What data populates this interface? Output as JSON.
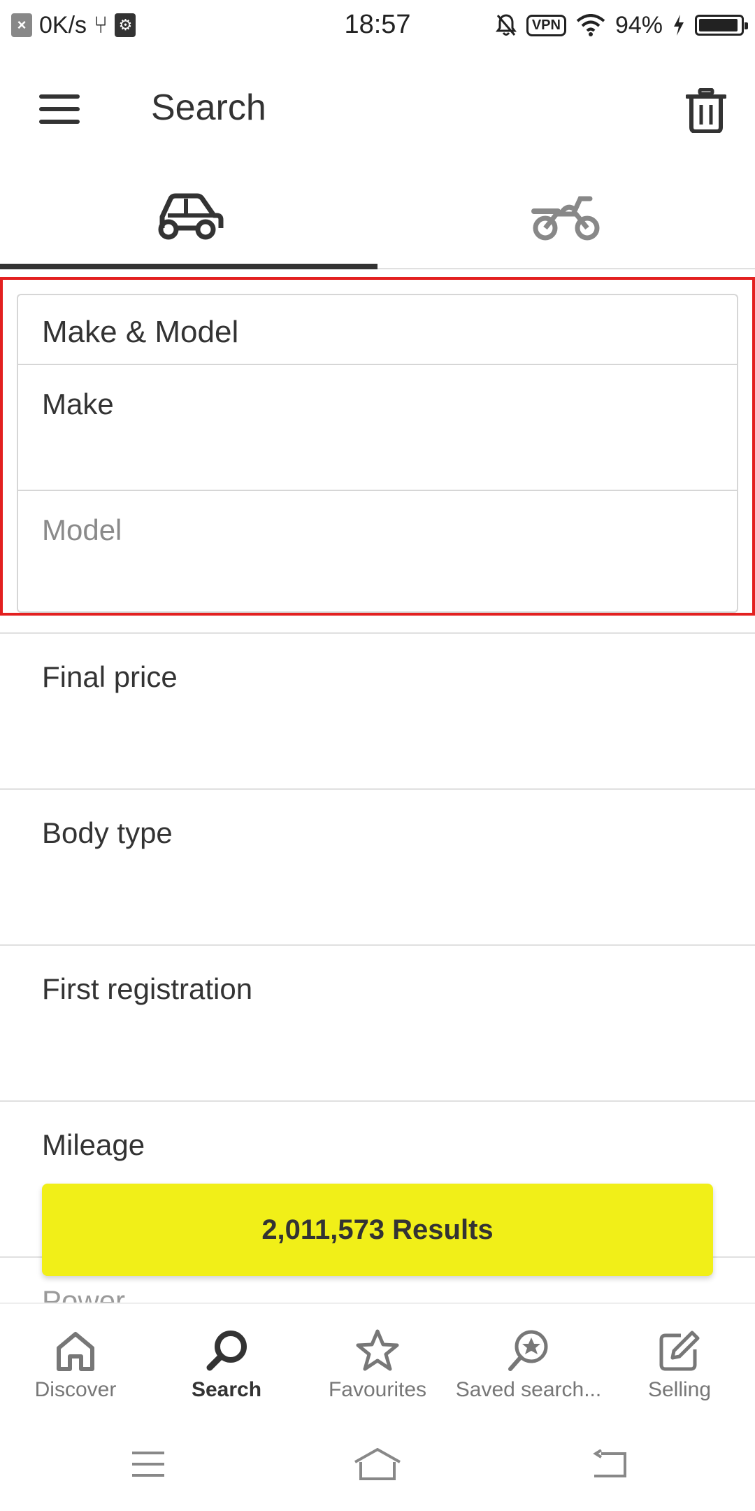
{
  "status_bar": {
    "speed": "0K/s",
    "time": "18:57",
    "vpn": "VPN",
    "battery": "94%"
  },
  "app_bar": {
    "title": "Search",
    "menu_icon": "hamburger-menu-icon",
    "trash_icon": "trash-icon"
  },
  "tabs": [
    {
      "icon": "car-icon",
      "active": true
    },
    {
      "icon": "motorbike-icon",
      "active": false
    }
  ],
  "make_model": {
    "header": "Make & Model",
    "make_label": "Make",
    "model_label": "Model"
  },
  "filters": [
    "Final price",
    "Body type",
    "First registration",
    "Mileage",
    "Power"
  ],
  "results_button": {
    "label": "2,011,573 Results",
    "color": "#f1ef18"
  },
  "bottom_nav": [
    {
      "label": "Discover",
      "icon": "home-icon",
      "active": false
    },
    {
      "label": "Search",
      "icon": "search-icon",
      "active": true
    },
    {
      "label": "Favourites",
      "icon": "star-icon",
      "active": false
    },
    {
      "label": "Saved search...",
      "icon": "saved-search-icon",
      "active": false
    },
    {
      "label": "Selling",
      "icon": "edit-icon",
      "active": false
    }
  ],
  "colors": {
    "highlight": "#e32020",
    "text": "#333333",
    "muted": "#8a8a8a"
  }
}
